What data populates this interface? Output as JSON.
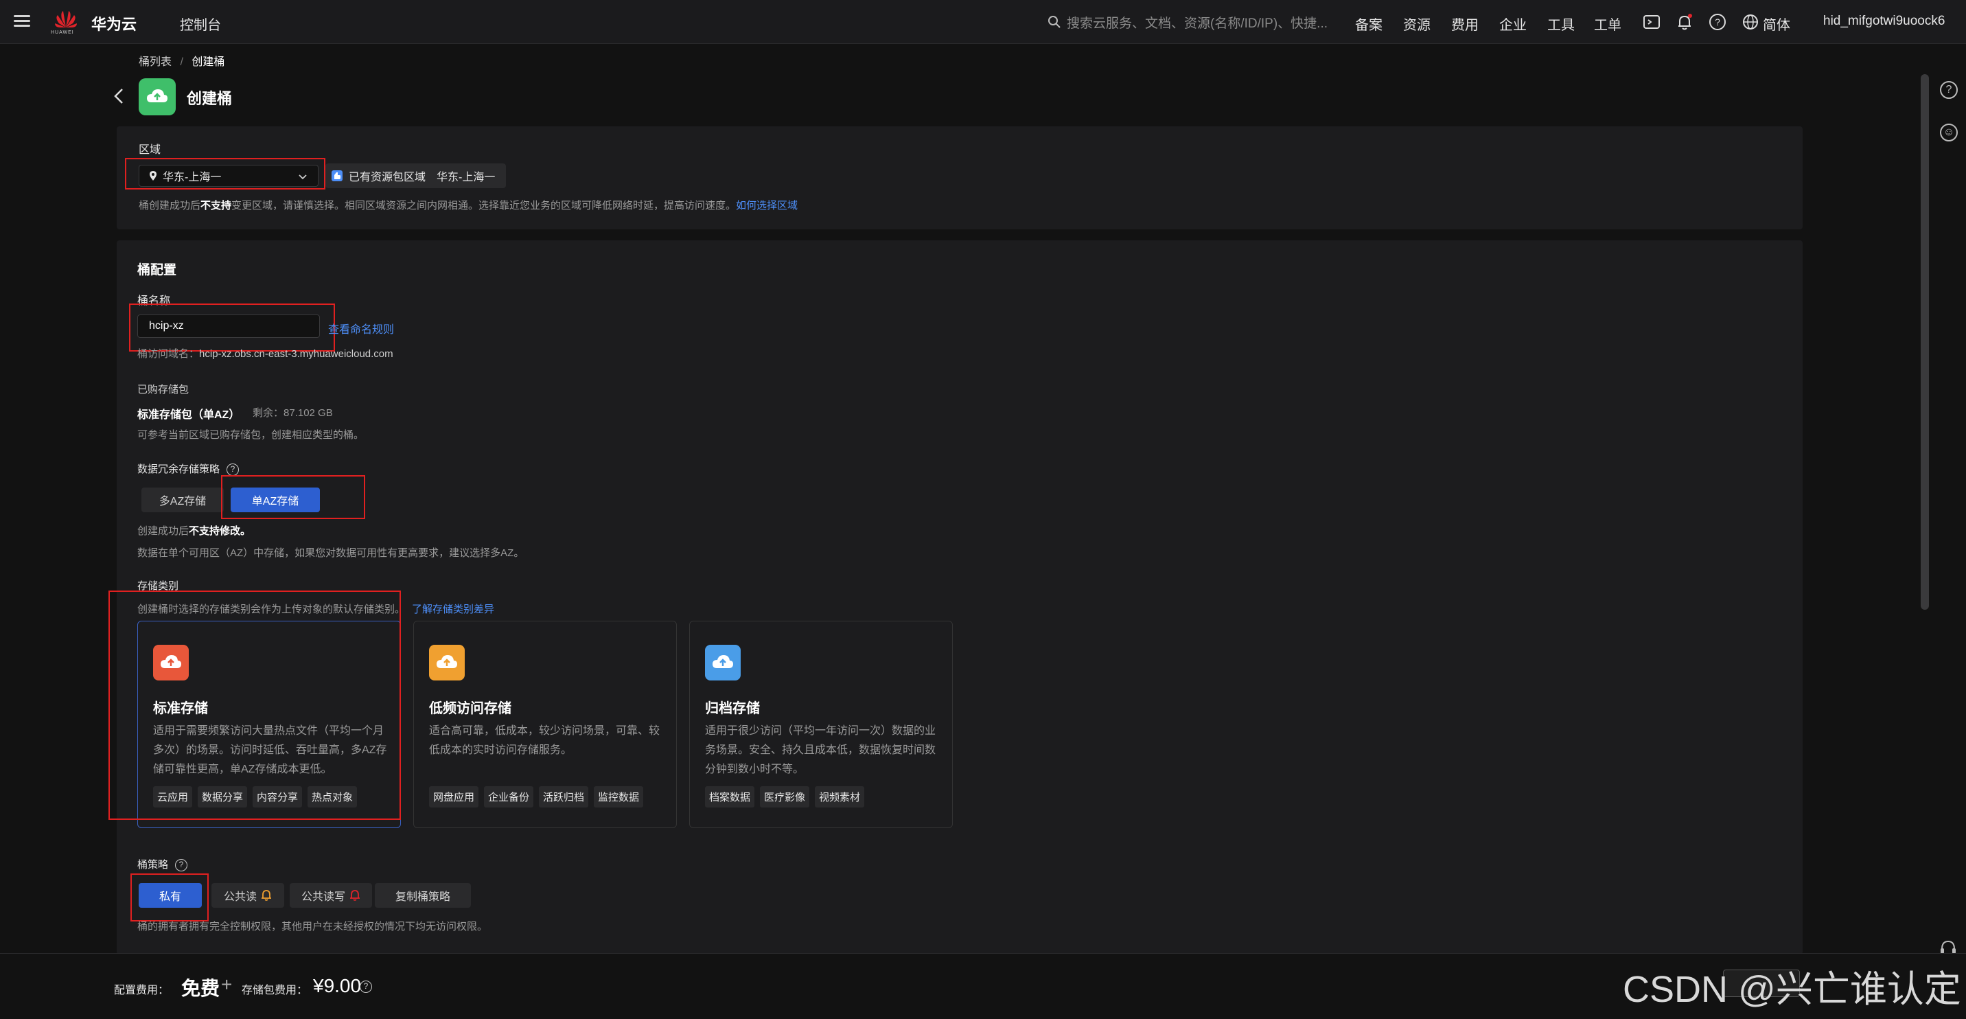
{
  "topbar": {
    "brand": "华为云",
    "logo_sub": "HUAWEI",
    "console": "控制台",
    "search_placeholder": "搜索云服务、文档、资源(名称/ID/IP)、快捷...",
    "nav": [
      "备案",
      "资源",
      "费用",
      "企业",
      "工具",
      "工单"
    ],
    "lang": "简体",
    "user": "hid_mifgotwi9uoock6"
  },
  "breadcrumb": {
    "parent": "桶列表",
    "sep": "/",
    "current": "创建桶"
  },
  "page_title": "创建桶",
  "region": {
    "label": "区域",
    "selected": "华东-上海一",
    "owned_label": "已有资源包区域",
    "owned_value": "华东-上海一",
    "hint_pre": "桶创建成功后",
    "hint_bold": "不支持",
    "hint_post": "变更区域，请谨慎选择。相同区域资源之间内网相通。选择靠近您业务的区域可降低网络时延，提高访问速度。",
    "hint_link": "如何选择区域"
  },
  "config": {
    "section_title": "桶配置",
    "name_label": "桶名称",
    "name_value": "hcip-xz",
    "name_rule_link": "查看命名规则",
    "domain_label": "桶访问域名：",
    "domain_value": "hcip-xz.obs.cn-east-3.myhuaweicloud.com",
    "purchased_label": "已购存储包",
    "package_name": "标准存储包（单AZ）",
    "package_remain": "剩余：87.102 GB",
    "package_hint": "可参考当前区域已购存储包，创建相应类型的桶。",
    "redundancy_label": "数据冗余存储策略",
    "multi_az": "多AZ存储",
    "single_az": "单AZ存储",
    "az_hint_pre": "创建成功后",
    "az_hint_bold": "不支持修改。",
    "az_hint2": "数据在单个可用区（AZ）中存储，如果您对数据可用性有更高要求，建议选择多AZ。",
    "class_label": "存储类别",
    "class_hint": "创建桶时选择的存储类别会作为上传对象的默认存储类别。",
    "class_link": "了解存储类别差异"
  },
  "storage_classes": [
    {
      "title": "标准存储",
      "desc": "适用于需要频繁访问大量热点文件（平均一个月多次）的场景。访问时延低、吞吐量高，多AZ存储可靠性更高，单AZ存储成本更低。",
      "tags": [
        "云应用",
        "数据分享",
        "内容分享",
        "热点对象"
      ],
      "color": "#e8573a"
    },
    {
      "title": "低频访问存储",
      "desc": "适合高可靠，低成本，较少访问场景，可靠、较低成本的实时访问存储服务。",
      "tags": [
        "网盘应用",
        "企业备份",
        "活跃归档",
        "监控数据"
      ],
      "color": "#f0a030"
    },
    {
      "title": "归档存储",
      "desc": "适用于很少访问（平均一年访问一次）数据的业务场景。安全、持久且成本低，数据恢复时间数分钟到数小时不等。",
      "tags": [
        "档案数据",
        "医疗影像",
        "视频素材"
      ],
      "color": "#4a9de8"
    }
  ],
  "policy": {
    "label": "桶策略",
    "private": "私有",
    "public_read": "公共读",
    "public_rw": "公共读写",
    "copy": "复制桶策略",
    "hint": "桶的拥有者拥有完全控制权限，其他用户在未经授权的情况下均无访问权限。"
  },
  "footer": {
    "config_fee_label": "配置费用：",
    "config_fee": "免费",
    "plus": "+",
    "package_fee_label": "存储包费用：",
    "package_fee": "¥9.00"
  },
  "watermark": "CSDN @兴亡谁认定"
}
